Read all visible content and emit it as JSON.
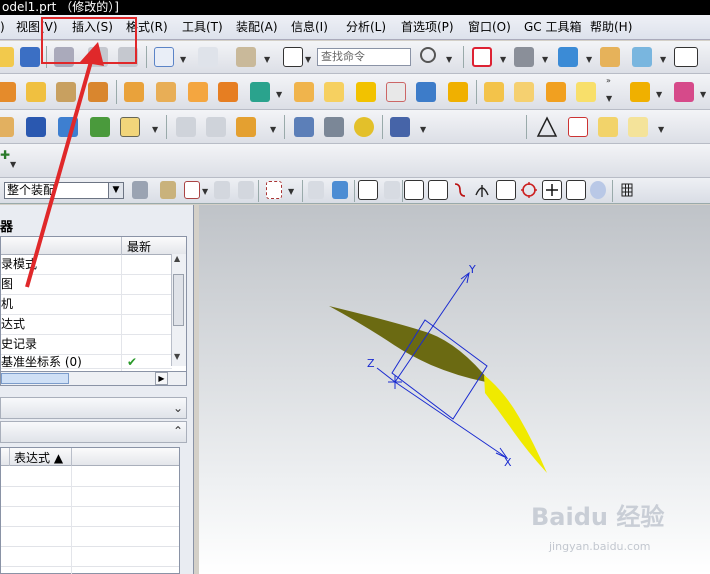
{
  "window": {
    "title": "odel1.prt （修改的）]"
  },
  "menu": {
    "items": [
      {
        "key": "partial",
        "label": ")"
      },
      {
        "key": "view",
        "label": "视图(V)"
      },
      {
        "key": "insert",
        "label": "插入(S)"
      },
      {
        "key": "format",
        "label": "格式(R)"
      },
      {
        "key": "tools",
        "label": "工具(T)"
      },
      {
        "key": "assembly",
        "label": "装配(A)"
      },
      {
        "key": "info",
        "label": "信息(I)"
      },
      {
        "key": "analysis",
        "label": "分析(L)"
      },
      {
        "key": "preferences",
        "label": "首选项(P)"
      },
      {
        "key": "window",
        "label": "窗口(O)"
      },
      {
        "key": "gc",
        "label": "GC 工具箱"
      },
      {
        "key": "help",
        "label": "帮助(H)"
      }
    ],
    "highlighted": "insert",
    "annotation_color": "#e0282a"
  },
  "toolbar": {
    "search_placeholder": "查找命令"
  },
  "selection_bar": {
    "filter_value": "整个装配"
  },
  "navigator": {
    "title": "器",
    "column_latest": "最新",
    "rows": [
      {
        "label": "录模式",
        "latest": ""
      },
      {
        "label": "图",
        "latest": ""
      },
      {
        "label": "机",
        "latest": ""
      },
      {
        "label": "达式",
        "latest": ""
      },
      {
        "label": "史记录",
        "latest": ""
      },
      {
        "label": "基准坐标系 (0)",
        "latest": "✔"
      }
    ],
    "details_column": "表达式 ▲"
  },
  "viewport": {
    "axis_labels": {
      "x": "X",
      "y": "Y",
      "z": "Z"
    },
    "axis_color": "#1a2bd0",
    "surface_dark_color": "#6b6a12",
    "surface_light_color": "#f0ea00"
  },
  "watermark": {
    "brand": "Baidu 经验",
    "url": "jingyan.baidu.com"
  }
}
